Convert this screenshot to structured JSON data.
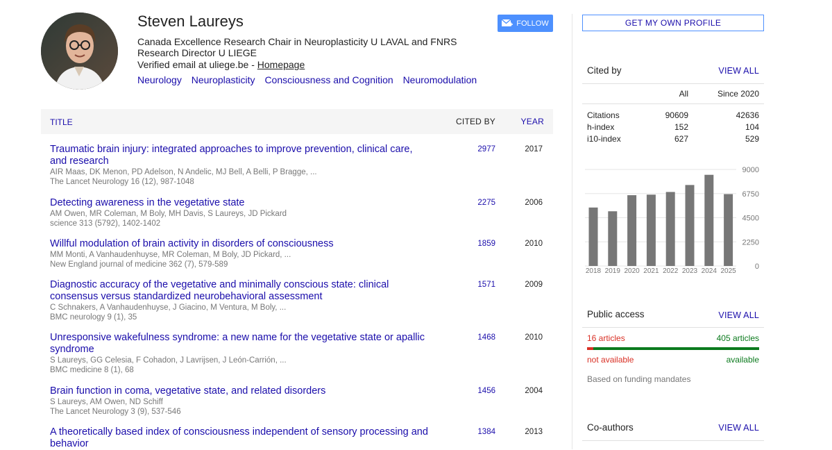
{
  "profile": {
    "name": "Steven Laureys",
    "affiliation": "Canada Excellence Research Chair in Neuroplasticity U LAVAL and FNRS Research Director U LIEGE",
    "email_text": "Verified email at uliege.be - ",
    "homepage_label": "Homepage",
    "interests": [
      "Neurology",
      "Neuroplasticity",
      "Consciousness and Cognition",
      "Neuromodulation"
    ],
    "follow_label": "FOLLOW"
  },
  "table": {
    "headers": {
      "title": "TITLE",
      "cited_by": "CITED BY",
      "year": "YEAR"
    },
    "rows": [
      {
        "title": "Traumatic brain injury: integrated approaches to improve prevention, clinical care, and research",
        "authors": "AIR Maas, DK Menon, PD Adelson, N Andelic, MJ Bell, A Belli, P Bragge, ...",
        "pub": "The Lancet Neurology 16 (12), 987-1048",
        "cited": "2977",
        "year": "2017"
      },
      {
        "title": "Detecting awareness in the vegetative state",
        "authors": "AM Owen, MR Coleman, M Boly, MH Davis, S Laureys, JD Pickard",
        "pub": "science 313 (5792), 1402-1402",
        "cited": "2275",
        "year": "2006"
      },
      {
        "title": "Willful modulation of brain activity in disorders of consciousness",
        "authors": "MM Monti, A Vanhaudenhuyse, MR Coleman, M Boly, JD Pickard, ...",
        "pub": "New England journal of medicine 362 (7), 579-589",
        "cited": "1859",
        "year": "2010"
      },
      {
        "title": "Diagnostic accuracy of the vegetative and minimally conscious state: clinical consensus versus standardized neurobehavioral assessment",
        "authors": "C Schnakers, A Vanhaudenhuyse, J Giacino, M Ventura, M Boly, ...",
        "pub": "BMC neurology 9 (1), 35",
        "cited": "1571",
        "year": "2009"
      },
      {
        "title": "Unresponsive wakefulness syndrome: a new name for the vegetative state or apallic syndrome",
        "authors": "S Laureys, GG Celesia, F Cohadon, J Lavrijsen, J León-Carrión, ...",
        "pub": "BMC medicine 8 (1), 68",
        "cited": "1468",
        "year": "2010"
      },
      {
        "title": "Brain function in coma, vegetative state, and related disorders",
        "authors": "S Laureys, AM Owen, ND Schiff",
        "pub": "The Lancet Neurology 3 (9), 537-546",
        "cited": "1456",
        "year": "2004"
      },
      {
        "title": "A theoretically based index of consciousness independent of sensory processing and behavior",
        "authors": "",
        "pub": "",
        "cited": "1384",
        "year": "2013"
      }
    ]
  },
  "sidebar": {
    "get_profile_label": "GET MY OWN PROFILE",
    "cited_by": {
      "title": "Cited by",
      "view_all": "VIEW ALL",
      "col_all": "All",
      "col_since": "Since 2020",
      "rows": [
        {
          "label": "Citations",
          "all": "90609",
          "since": "42636"
        },
        {
          "label": "h-index",
          "all": "152",
          "since": "104"
        },
        {
          "label": "i10-index",
          "all": "627",
          "since": "529"
        }
      ]
    },
    "public_access": {
      "title": "Public access",
      "view_all": "VIEW ALL",
      "not_available_count": "16 articles",
      "available_count": "405 articles",
      "not_available_label": "not available",
      "available_label": "available",
      "note": "Based on funding mandates",
      "not_available_fraction": 0.038,
      "red": "#d93025",
      "green": "#0b7a1d"
    },
    "coauthors": {
      "title": "Co-authors",
      "view_all": "VIEW ALL"
    }
  },
  "chart_data": {
    "type": "bar",
    "categories": [
      "2018",
      "2019",
      "2020",
      "2021",
      "2022",
      "2023",
      "2024",
      "2025"
    ],
    "values": [
      5450,
      5100,
      6600,
      6650,
      6900,
      7550,
      8500,
      6700
    ],
    "yticks": [
      "9000",
      "6750",
      "4500",
      "2250",
      "0"
    ],
    "ylim": [
      0,
      9000
    ],
    "bar_color": "#777777",
    "grid": true
  }
}
